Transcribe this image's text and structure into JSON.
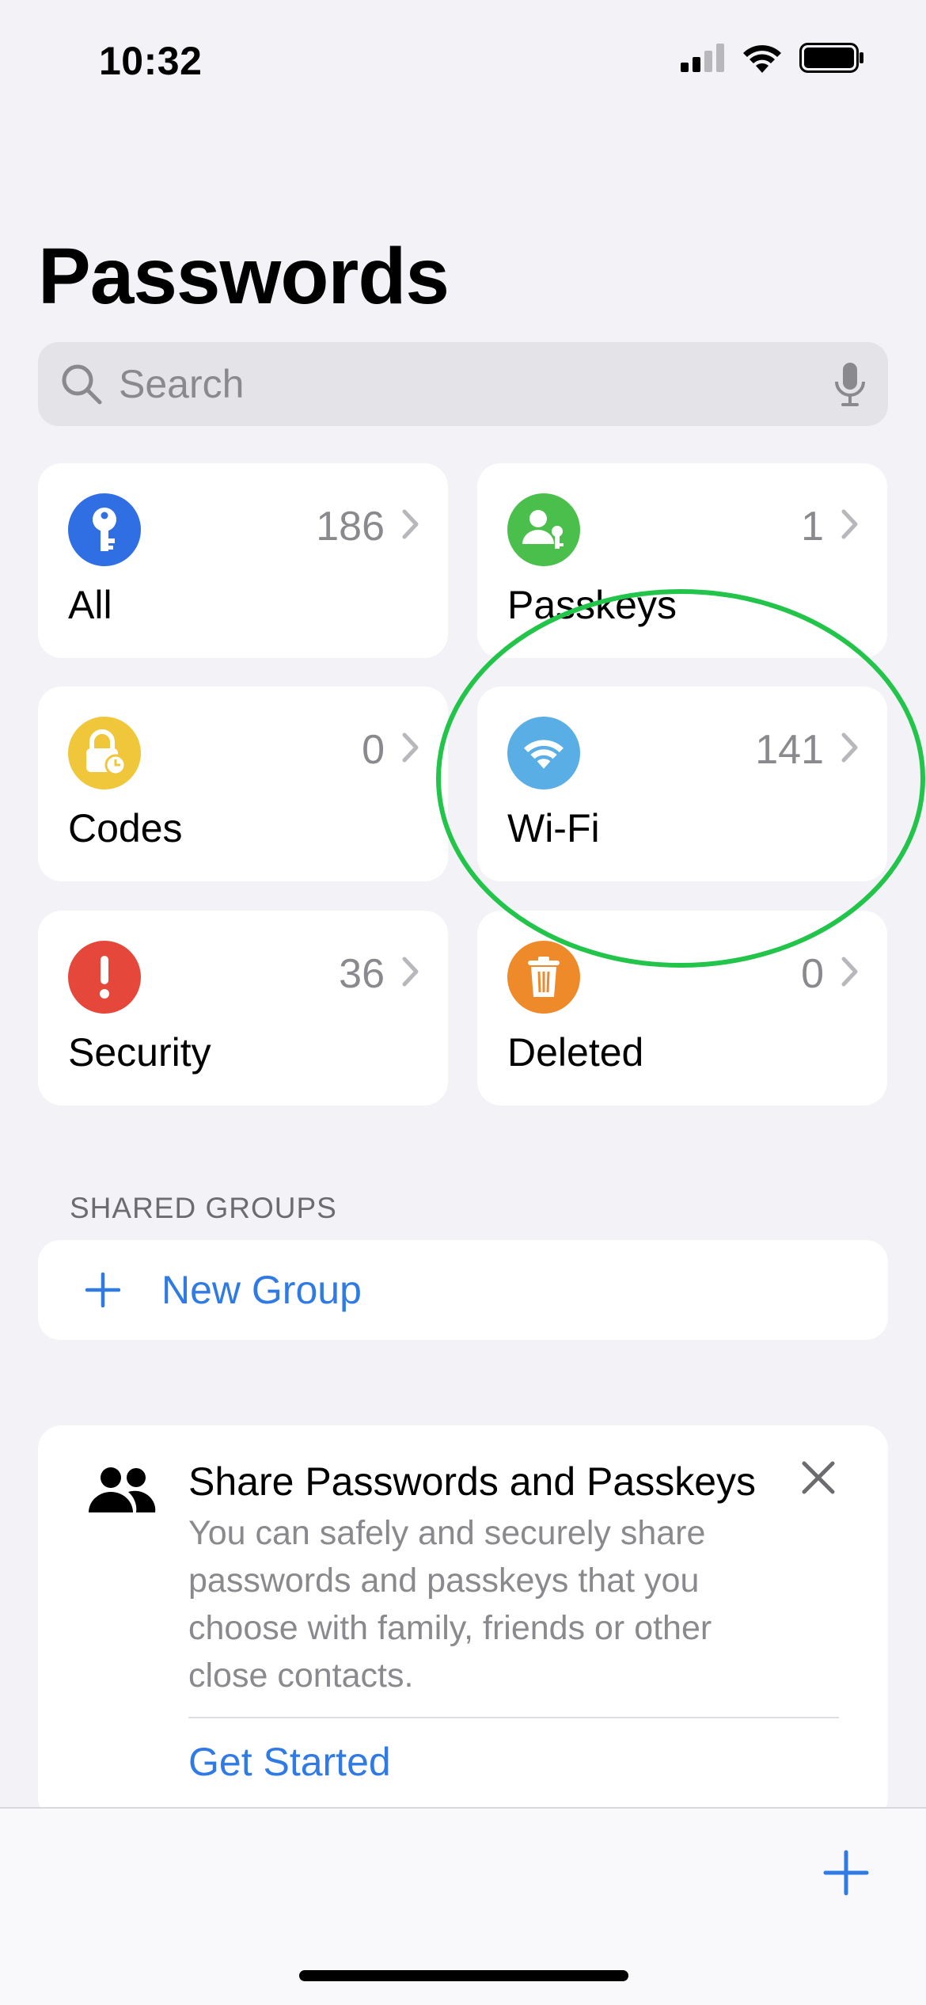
{
  "status_bar": {
    "time": "10:32"
  },
  "page": {
    "title": "Passwords"
  },
  "search": {
    "placeholder": "Search"
  },
  "categories": [
    {
      "label": "All",
      "count": "186",
      "icon": "key-icon",
      "color": "#2f6ee3"
    },
    {
      "label": "Passkeys",
      "count": "1",
      "icon": "person-key-icon",
      "color": "#4bbf4b"
    },
    {
      "label": "Codes",
      "count": "0",
      "icon": "lock-clock-icon",
      "color": "#f0c63a"
    },
    {
      "label": "Wi-Fi",
      "count": "141",
      "icon": "wifi-icon",
      "color": "#5aaee6"
    },
    {
      "label": "Security",
      "count": "36",
      "icon": "exclamation-icon",
      "color": "#e5473b"
    },
    {
      "label": "Deleted",
      "count": "0",
      "icon": "trash-icon",
      "color": "#ee8a2a"
    }
  ],
  "shared_groups": {
    "header": "SHARED GROUPS",
    "new_group_label": "New Group"
  },
  "share_card": {
    "title": "Share Passwords and Passkeys",
    "body": "You can safely and securely share passwords and passkeys that you choose with family, friends or other close contacts.",
    "link": "Get Started"
  },
  "colors": {
    "accent": "#2f7ae5",
    "annotation": "#22c44a"
  }
}
